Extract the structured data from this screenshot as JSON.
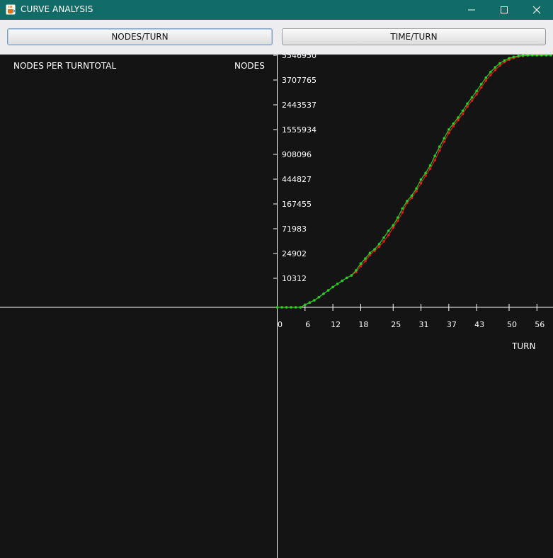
{
  "window": {
    "title": "CURVE ANALYSIS",
    "app_icon": "java-cup-icon",
    "controls": [
      "minimize-icon",
      "maximize-icon",
      "close-icon"
    ]
  },
  "toolbar": {
    "nodes_turn_label": "NODES/TURN",
    "time_turn_label": "TIME/TURN"
  },
  "colors": {
    "titlebar": "#116b66",
    "plot_background": "#141414",
    "axis": "#ffffff",
    "series_green": "#1fd21f",
    "series_red": "#e01a1a"
  },
  "chart_data": {
    "type": "line",
    "title": "NODES PER TURNTOTAL",
    "ylabel": "NODES",
    "xlabel": "TURN",
    "y_scale": "nonlinear (tick labels printed as shown)",
    "x_ticks": [
      0,
      6,
      12,
      18,
      25,
      31,
      37,
      43,
      50,
      56
    ],
    "y_ticks": [
      "10312",
      "24902",
      "71983",
      "167455",
      "444827",
      "908096",
      "1555934",
      "2443537",
      "3707765",
      "5546950"
    ],
    "xlim": [
      0,
      60
    ],
    "legend": "none",
    "series": [
      {
        "color": "#1fd21f",
        "x": [
          0,
          1,
          2,
          3,
          4,
          5,
          6,
          7,
          8,
          9,
          10,
          11,
          12,
          13,
          14,
          15,
          16,
          17,
          18,
          19,
          20,
          21,
          22,
          23,
          24,
          25,
          26,
          27,
          28,
          29,
          30,
          31,
          32,
          33,
          34,
          35,
          36,
          37,
          38,
          39,
          40,
          41,
          42,
          43,
          44,
          45,
          46,
          47,
          48,
          49,
          50,
          51,
          52,
          53,
          54,
          55,
          56,
          57,
          58,
          59
        ],
        "y": [
          0,
          0,
          0,
          0,
          0,
          0,
          900,
          1700,
          2500,
          3600,
          4800,
          6000,
          7200,
          8300,
          9400,
          10600,
          12000,
          15000,
          19000,
          22000,
          26000,
          33000,
          43000,
          55000,
          68000,
          85000,
          115000,
          150000,
          200000,
          260000,
          340000,
          440000,
          560000,
          700000,
          880000,
          1110000,
          1330000,
          1560000,
          1770000,
          1990000,
          2230000,
          2500000,
          2820000,
          3150000,
          3500000,
          3880000,
          4300000,
          4650000,
          4950000,
          5160000,
          5320000,
          5420000,
          5490000,
          5530000,
          5546950,
          5546950,
          5546950,
          5546950,
          5546950,
          5546950
        ]
      },
      {
        "color": "#e01a1a",
        "x": [
          0,
          1,
          2,
          3,
          4,
          5,
          6,
          7,
          8,
          9,
          10,
          11,
          12,
          13,
          14,
          15,
          16,
          17,
          18,
          19,
          20,
          21,
          22,
          23,
          24,
          25,
          26,
          27,
          28,
          29,
          30,
          31,
          32,
          33,
          34,
          35,
          36,
          37,
          38,
          39,
          40,
          41,
          42,
          43,
          44,
          45,
          46,
          47,
          48,
          49,
          50,
          51,
          52,
          53,
          54,
          55,
          56,
          57,
          58,
          59
        ],
        "y": [
          0,
          0,
          0,
          0,
          0,
          0,
          900,
          1700,
          2500,
          3600,
          4800,
          6000,
          7200,
          8300,
          9400,
          10600,
          12000,
          14000,
          17500,
          20500,
          24000,
          30000,
          38000,
          48000,
          60000,
          76000,
          103000,
          135000,
          180000,
          235000,
          310000,
          400000,
          510000,
          640000,
          800000,
          1010000,
          1240000,
          1470000,
          1680000,
          1900000,
          2120000,
          2380000,
          2660000,
          2980000,
          3330000,
          3680000,
          4080000,
          4450000,
          4780000,
          5040000,
          5220000,
          5350000,
          5440000,
          5500000,
          5530000,
          5546950,
          5546950,
          5546950,
          5546950,
          5546950
        ]
      }
    ]
  }
}
